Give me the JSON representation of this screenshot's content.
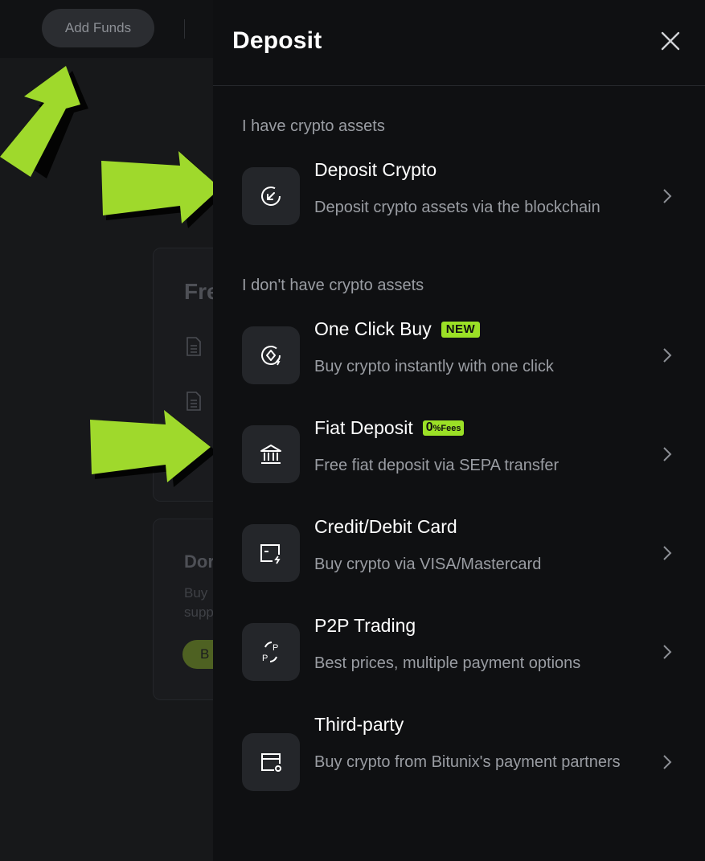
{
  "background": {
    "add_funds_label": "Add Funds",
    "card1_title": "Fre",
    "card2_title": "Dor",
    "card2_line1": "Buy",
    "card2_line2": "supp",
    "card2_button": "B"
  },
  "panel": {
    "title": "Deposit",
    "close_icon": "close-icon",
    "sections": [
      {
        "label": "I have crypto assets"
      },
      {
        "label": "I don't have crypto assets"
      }
    ],
    "options": [
      {
        "title": "Deposit Crypto",
        "desc": "Deposit crypto assets via the blockchain",
        "icon": "arrow-in-circle-icon"
      },
      {
        "title": "One Click Buy",
        "badge": "NEW",
        "desc": "Buy crypto instantly with one click",
        "icon": "lightning-coin-icon"
      },
      {
        "title": "Fiat Deposit",
        "badge_big": "0",
        "badge_small": "%Fees",
        "desc": "Free fiat deposit via SEPA transfer",
        "icon": "bank-icon"
      },
      {
        "title": "Credit/Debit Card",
        "desc": "Buy crypto via VISA/Mastercard",
        "icon": "card-icon"
      },
      {
        "title": "P2P Trading",
        "desc": "Best prices, multiple payment options",
        "icon": "p2p-icon"
      },
      {
        "title": "Third-party",
        "desc": "Buy crypto from Bitunix's payment partners",
        "icon": "third-party-icon"
      }
    ]
  },
  "colors": {
    "accent": "#9be026",
    "arrow": "#9fd92c",
    "panel_bg": "#0f1012",
    "icon_bg": "#24262a"
  }
}
